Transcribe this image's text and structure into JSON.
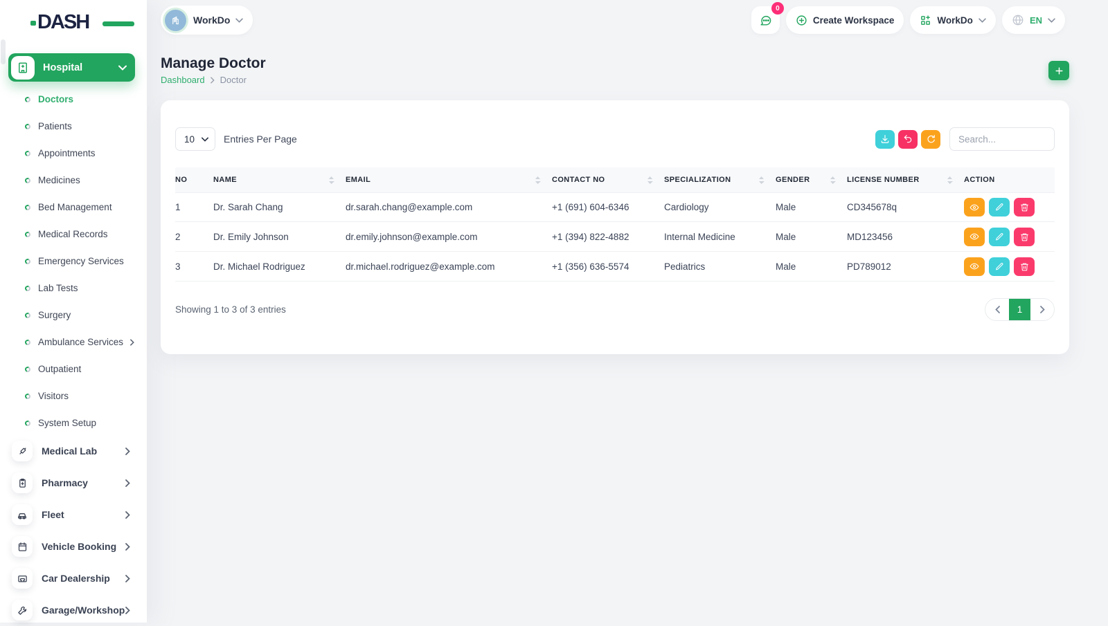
{
  "app": {
    "logo_text": "DASH"
  },
  "header": {
    "workspace_button": {
      "label": "WorkDo"
    },
    "messages_badge": "0",
    "create_workspace_label": "Create Workspace",
    "workdo_menu_label": "WorkDo",
    "language": "EN"
  },
  "sidebar": {
    "hospital_label": "Hospital",
    "sub_items": [
      {
        "label": "Doctors",
        "active": true,
        "has_children": false
      },
      {
        "label": "Patients",
        "active": false,
        "has_children": false
      },
      {
        "label": "Appointments",
        "active": false,
        "has_children": false
      },
      {
        "label": "Medicines",
        "active": false,
        "has_children": false
      },
      {
        "label": "Bed Management",
        "active": false,
        "has_children": false
      },
      {
        "label": "Medical Records",
        "active": false,
        "has_children": false
      },
      {
        "label": "Emergency Services",
        "active": false,
        "has_children": false
      },
      {
        "label": "Lab Tests",
        "active": false,
        "has_children": false
      },
      {
        "label": "Surgery",
        "active": false,
        "has_children": false
      },
      {
        "label": "Ambulance Services",
        "active": false,
        "has_children": true
      },
      {
        "label": "Outpatient",
        "active": false,
        "has_children": false
      },
      {
        "label": "Visitors",
        "active": false,
        "has_children": false
      },
      {
        "label": "System Setup",
        "active": false,
        "has_children": false
      }
    ],
    "modules": [
      {
        "label": "Medical Lab",
        "icon": "syringe-icon"
      },
      {
        "label": "Pharmacy",
        "icon": "clipboard-icon"
      },
      {
        "label": "Fleet",
        "icon": "car-icon"
      },
      {
        "label": "Vehicle Booking",
        "icon": "calendar-icon"
      },
      {
        "label": "Car Dealership",
        "icon": "car-dealership-icon"
      },
      {
        "label": "Garage/Workshop",
        "icon": "tools-icon"
      }
    ]
  },
  "page": {
    "title": "Manage Doctor",
    "breadcrumb_home": "Dashboard",
    "breadcrumb_current": "Doctor"
  },
  "card": {
    "entries_select_value": "10",
    "entries_label": "Entries Per Page",
    "search_placeholder": "Search...",
    "table": {
      "columns": [
        {
          "label": "NO",
          "sortable": false
        },
        {
          "label": "NAME",
          "sortable": true
        },
        {
          "label": "EMAIL",
          "sortable": true
        },
        {
          "label": "CONTACT NO",
          "sortable": true
        },
        {
          "label": "SPECIALIZATION",
          "sortable": true
        },
        {
          "label": "GENDER",
          "sortable": true
        },
        {
          "label": "LICENSE NUMBER",
          "sortable": true
        },
        {
          "label": "ACTION",
          "sortable": false
        }
      ],
      "rows": [
        {
          "no": "1",
          "name": "Dr. Sarah Chang",
          "email": "dr.sarah.chang@example.com",
          "contact": "+1 (691) 604-6346",
          "specialization": "Cardiology",
          "gender": "Male",
          "license": "CD345678q"
        },
        {
          "no": "2",
          "name": "Dr. Emily Johnson",
          "email": "dr.emily.johnson@example.com",
          "contact": "+1 (394) 822-4882",
          "specialization": "Internal Medicine",
          "gender": "Male",
          "license": "MD123456"
        },
        {
          "no": "3",
          "name": "Dr. Michael Rodriguez",
          "email": "dr.michael.rodriguez@example.com",
          "contact": "+1 (356) 636-5574",
          "specialization": "Pediatrics",
          "gender": "Male",
          "license": "PD789012"
        }
      ]
    },
    "footer": {
      "showing_text": "Showing 1 to 3 of 3 entries",
      "current_page": "1"
    }
  },
  "colors": {
    "primary_green": "#22a55e",
    "link_green": "#2fae6e",
    "teal": "#3fd0da",
    "pink": "#fb3a6c",
    "undo_pink": "#f73164",
    "orange": "#fba21d",
    "badge_pink": "#fd2e77",
    "avatar_blue": "#92b9d9"
  }
}
